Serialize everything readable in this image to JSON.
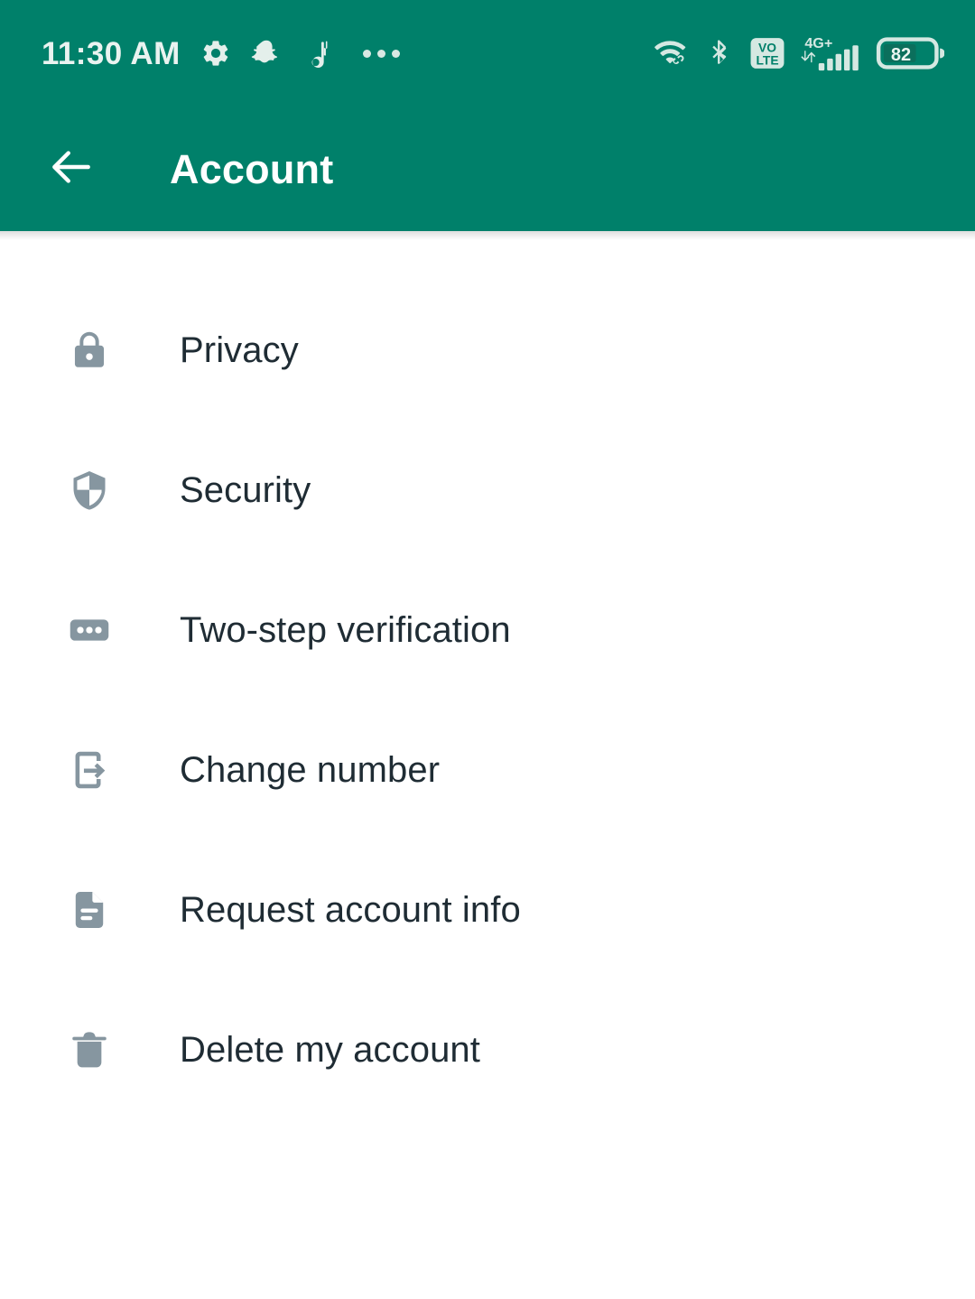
{
  "status_bar": {
    "time": "11:30 AM",
    "left_icons": [
      {
        "name": "settings-gear-icon",
        "label": "gear-icon"
      },
      {
        "name": "snapchat-icon",
        "label": "ghost-icon"
      },
      {
        "name": "tiktok-music-note-icon",
        "label": "music-note-icon"
      },
      {
        "name": "more-notifications-icon",
        "label": "ellipsis-icon"
      }
    ],
    "right_icons": [
      {
        "name": "wifi-icon",
        "label": "wifi-with-link"
      },
      {
        "name": "bluetooth-icon",
        "label": "bluetooth"
      },
      {
        "name": "volte-icon",
        "label": "VoLTE"
      },
      {
        "name": "signal-icon",
        "label": "signal-bars"
      },
      {
        "name": "battery-icon",
        "label": "battery"
      }
    ],
    "volte_top": "VO",
    "volte_bottom": "LTE",
    "network_type": "4G+",
    "battery_percent": "82",
    "battery_fill_ratio": 0.64,
    "signal_bars_total": 5,
    "signal_bars_active": 5
  },
  "app_bar": {
    "title": "Account",
    "back_icon": "back-arrow-icon"
  },
  "colors": {
    "header_green": "#00806a",
    "icon_gray": "#8696a0",
    "text_dark": "#1f2c34",
    "background": "#ffffff"
  },
  "settings_list": {
    "items": [
      {
        "label": "Privacy",
        "icon": "lock-icon"
      },
      {
        "label": "Security",
        "icon": "shield-icon"
      },
      {
        "label": "Two-step verification",
        "icon": "password-dots-icon"
      },
      {
        "label": "Change number",
        "icon": "phone-arrow-icon"
      },
      {
        "label": "Request account info",
        "icon": "document-icon"
      },
      {
        "label": "Delete my account",
        "icon": "trash-icon"
      }
    ]
  }
}
